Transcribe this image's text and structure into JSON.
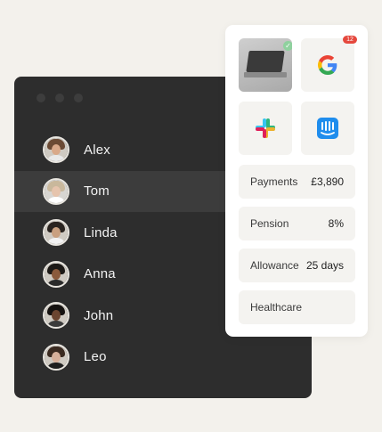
{
  "people": [
    {
      "name": "Alex"
    },
    {
      "name": "Tom"
    },
    {
      "name": "Linda"
    },
    {
      "name": "Anna"
    },
    {
      "name": "John"
    },
    {
      "name": "Leo"
    }
  ],
  "selected_person": "Tom",
  "apps": {
    "google_badge": "12"
  },
  "benefits": [
    {
      "label": "Payments",
      "value": "£3,890"
    },
    {
      "label": "Pension",
      "value": "8%"
    },
    {
      "label": "Allowance",
      "value": "25 days"
    },
    {
      "label": "Healthcare",
      "value": ""
    }
  ],
  "colors": {
    "window_bg": "#2d2d2d",
    "selected_row": "#3c3c3c",
    "page_bg": "#f3f1ec",
    "badge": "#e5483d",
    "intercom": "#1f8ded"
  }
}
